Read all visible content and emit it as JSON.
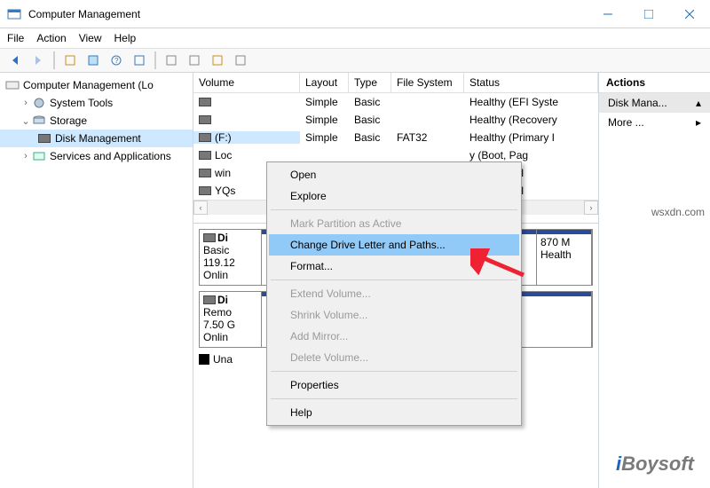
{
  "window": {
    "title": "Computer Management"
  },
  "menu": {
    "file": "File",
    "action": "Action",
    "view": "View",
    "help": "Help"
  },
  "tree": {
    "root": "Computer Management (Lo",
    "system_tools": "System Tools",
    "storage": "Storage",
    "disk_mgmt": "Disk Management",
    "services": "Services and Applications"
  },
  "volumes": {
    "headers": {
      "volume": "Volume",
      "layout": "Layout",
      "type": "Type",
      "fs": "File System",
      "status": "Status"
    },
    "rows": [
      {
        "vol": "",
        "layout": "Simple",
        "type": "Basic",
        "fs": "",
        "status": "Healthy (EFI Syste"
      },
      {
        "vol": "",
        "layout": "Simple",
        "type": "Basic",
        "fs": "",
        "status": "Healthy (Recovery"
      },
      {
        "vol": "(F:)",
        "layout": "Simple",
        "type": "Basic",
        "fs": "FAT32",
        "status": "Healthy (Primary I"
      },
      {
        "vol": "Loc",
        "layout": "",
        "type": "",
        "fs": "",
        "status": "y (Boot, Pag"
      },
      {
        "vol": "win",
        "layout": "",
        "type": "",
        "fs": "",
        "status": "y (Primary I"
      },
      {
        "vol": "YQs",
        "layout": "",
        "type": "",
        "fs": "",
        "status": "y (Primary I"
      }
    ]
  },
  "disks": {
    "d0": {
      "name": "Di",
      "type": "Basic",
      "size": "119.12",
      "state": "Onlin",
      "p_size": "870 M",
      "p_status": "Health"
    },
    "d1": {
      "name": "Di",
      "type": "Remo",
      "size": "7.50 G",
      "state": "Onlin"
    },
    "unalloc": "Una"
  },
  "actions": {
    "title": "Actions",
    "item1": "Disk Mana...",
    "item2": "More ..."
  },
  "ctx": {
    "open": "Open",
    "explore": "Explore",
    "mark": "Mark Partition as Active",
    "change": "Change Drive Letter and Paths...",
    "format": "Format...",
    "extend": "Extend Volume...",
    "shrink": "Shrink Volume...",
    "mirror": "Add Mirror...",
    "delete": "Delete Volume...",
    "props": "Properties",
    "help": "Help"
  },
  "wm": {
    "a": "i",
    "b": "Boysoft"
  },
  "wsx": "wsxdn.com"
}
